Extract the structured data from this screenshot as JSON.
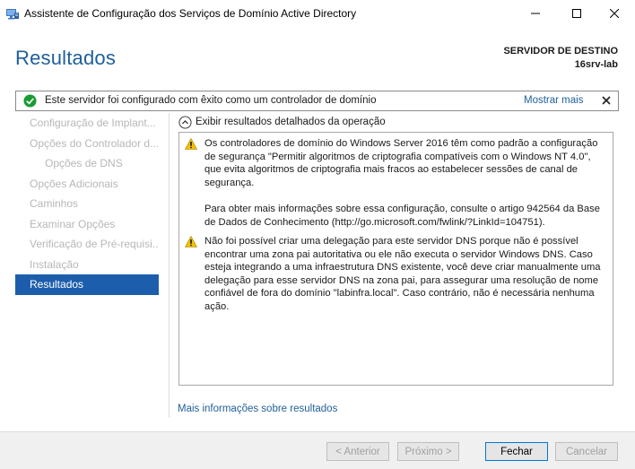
{
  "window": {
    "title": "Assistente de Configuração dos Serviços de Domínio Active Directory"
  },
  "header": {
    "page_title": "Resultados",
    "destination_label": "SERVIDOR DE DESTINO",
    "destination_server": "16srv-lab"
  },
  "notification": {
    "text": "Este servidor foi configurado com êxito como um controlador de domínio",
    "more_label": "Mostrar mais",
    "status_color": "#1a9b32"
  },
  "sidebar": {
    "items": [
      {
        "label": "Configuração de Implant..."
      },
      {
        "label": "Opções do Controlador d..."
      },
      {
        "label": "Opções de DNS"
      },
      {
        "label": "Opções Adicionais"
      },
      {
        "label": "Caminhos"
      },
      {
        "label": "Examinar Opções"
      },
      {
        "label": "Verificação de Pré-requisi..."
      },
      {
        "label": "Instalação"
      },
      {
        "label": "Resultados"
      }
    ],
    "active_color": "#1d5eac"
  },
  "results": {
    "expander_label": "Exibir resultados detalhados da operação",
    "entries": [
      {
        "icon": "warning-icon",
        "paragraphs": [
          "Os controladores de domínio do Windows Server 2016 têm como padrão a configuração de segurança \"Permitir algoritmos de criptografia compatíveis com o Windows NT 4.0\", que evita algoritmos de criptografia mais fracos ao estabelecer sessões de canal de segurança.",
          "Para obter mais informações sobre essa configuração, consulte o artigo 942564 da Base de Dados de Conhecimento (http://go.microsoft.com/fwlink/?LinkId=104751)."
        ]
      },
      {
        "icon": "warning-icon",
        "paragraphs": [
          "Não foi possível criar uma delegação para este servidor DNS porque não é possível encontrar uma zona pai autoritativa ou ele não executa o servidor Windows DNS. Caso esteja integrando a uma infraestrutura DNS existente, você deve criar manualmente uma delegação para esse servidor DNS na zona pai, para assegurar uma resolução de nome confiável de fora do domínio \"labinfra.local\". Caso contrário, não é necessária nenhuma ação."
        ]
      }
    ],
    "more_link": "Mais informações sobre resultados"
  },
  "footer": {
    "prev_label": "< Anterior",
    "next_label": "Próximo >",
    "close_label": "Fechar",
    "cancel_label": "Cancelar"
  }
}
